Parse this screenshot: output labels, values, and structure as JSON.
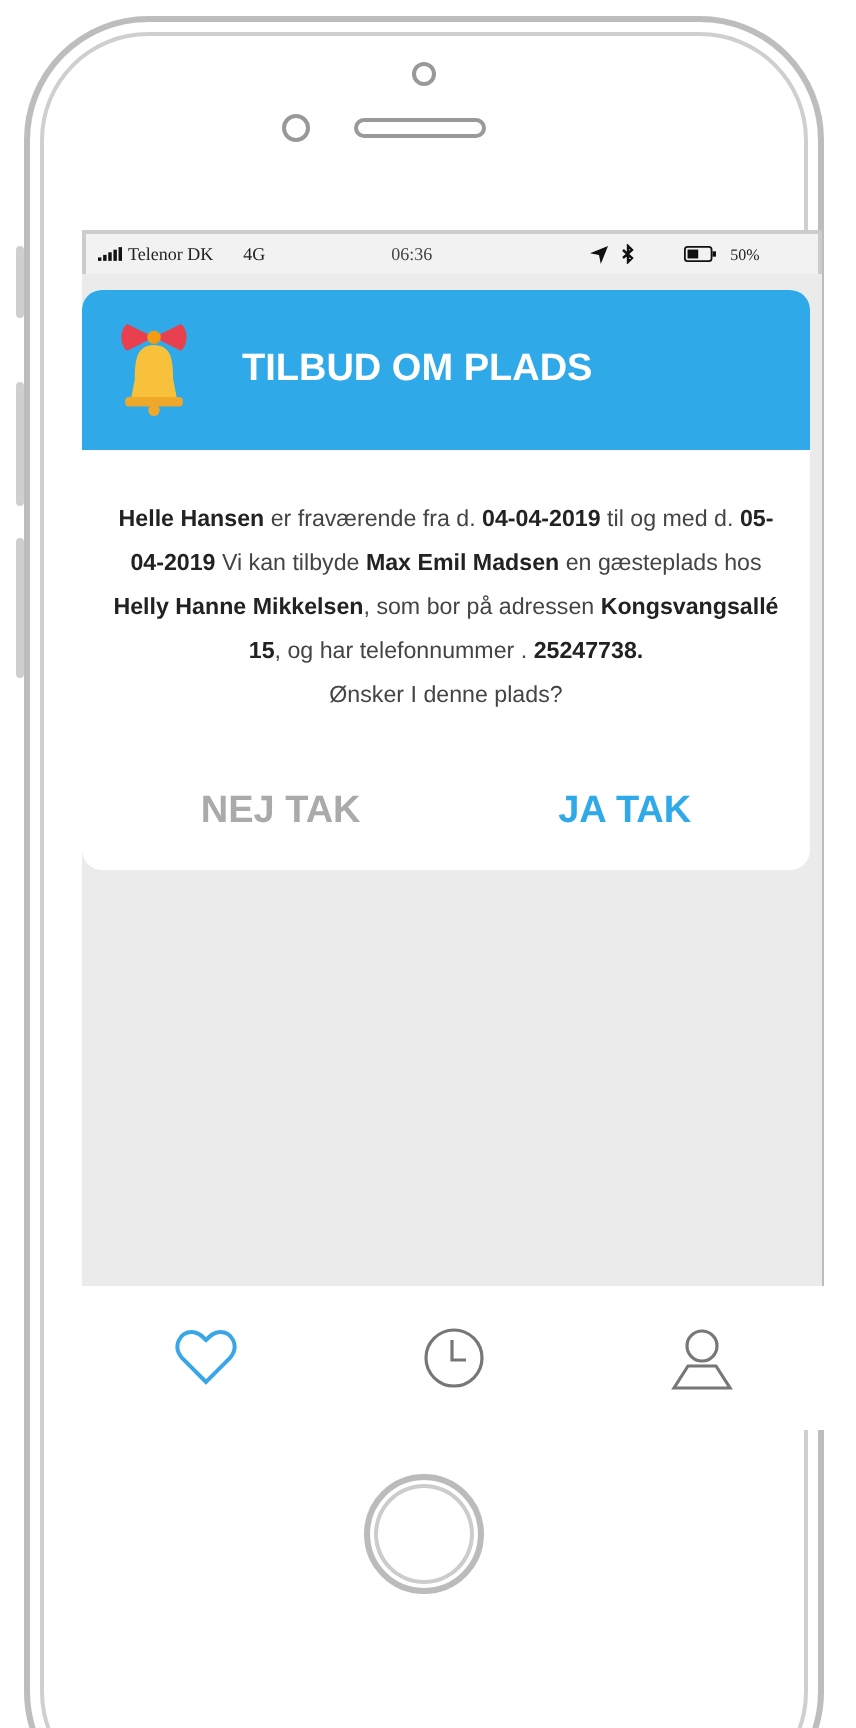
{
  "status_bar": {
    "carrier": "Telenor DK",
    "network": "4G",
    "time": "06:36",
    "battery": "50%"
  },
  "dialog": {
    "title": "TILBUD OM PLADS",
    "message": "**Helle Hansen** er fraværende fra d. **04-04-2019** til og med d. **05-04-2019** Vi kan tilbyde **Max Emil Madsen** en gæsteplads hos **Helly Hanne Mikkelsen**, som bor på adressen **Kongsvangsallé 15**, og har telefonnummer . **25247738.**",
    "question": "Ønsker I denne plads?",
    "buttons": [
      {
        "label": "NEJ TAK",
        "kind": "decline"
      },
      {
        "label": "JA TAK",
        "kind": "accept"
      }
    ]
  },
  "tab_bar": [
    {
      "kind": "heart",
      "selected": true
    },
    {
      "kind": "clock",
      "selected": false
    },
    {
      "kind": "profile",
      "selected": false
    }
  ]
}
